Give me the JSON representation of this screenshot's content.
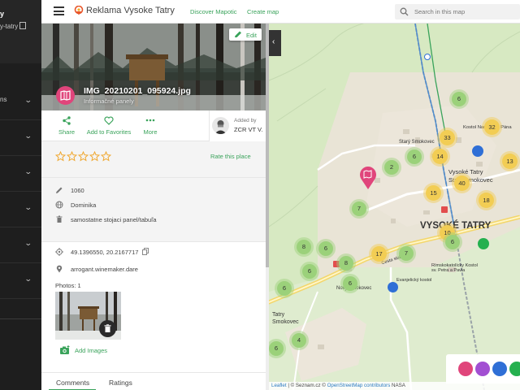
{
  "sidebar": {
    "title": "y",
    "subtitle": "y-tatry",
    "items": [
      {
        "label": "ns"
      },
      {
        "label": ""
      },
      {
        "label": ""
      },
      {
        "label": ""
      },
      {
        "label": ""
      },
      {
        "label": ""
      },
      {
        "label": ""
      }
    ]
  },
  "header": {
    "title": "Reklama Vysoke Tatry",
    "nav": [
      "Discover Mapotic",
      "Create map"
    ],
    "search_placeholder": "Search in this map"
  },
  "place": {
    "image_title": "IMG_20210201_095924.jpg",
    "category": "Informačné panely",
    "edit_label": "Edit",
    "actions": [
      {
        "label": "Share",
        "icon": "share-icon"
      },
      {
        "label": "Add to Favorites",
        "icon": "heart-icon"
      },
      {
        "label": "More",
        "icon": "more-icon"
      }
    ],
    "added_by_label": "Added by",
    "added_by_user": "ZCR VT V.",
    "rating": {
      "stars": 0,
      "max": 5,
      "rate_label": "Rate this place"
    },
    "details": [
      {
        "icon": "pencil-icon",
        "value": "1060"
      },
      {
        "icon": "globe-icon",
        "value": "Dominika"
      },
      {
        "icon": "trash-icon",
        "value": "samostatne stojaci panel/tabuľa"
      }
    ],
    "coordinates": "49.1396550, 20.2167717",
    "address": "arrogant.winemaker.dare",
    "photos_label": "Photos: 1",
    "add_images_label": "Add Images",
    "tabs": [
      "Comments",
      "Ratings"
    ]
  },
  "map": {
    "town_label": "VYSOKÉ TATRY",
    "labels": [
      "Starý Smokovec",
      "Vysoké Tatry",
      "Starý Smokovec",
      "Kostol Narodenia Pána",
      "Rímskokatolícky Kostol sv. Petra a Pavla",
      "Evanjelický kostol",
      "Nový Smokovec",
      "Tatry",
      "Smokovec",
      "Cesta slobody"
    ],
    "clusters": [
      {
        "count": "6",
        "color": "green"
      },
      {
        "count": "33",
        "color": "yellow"
      },
      {
        "count": "14",
        "color": "yellow"
      },
      {
        "count": "6",
        "color": "green"
      },
      {
        "count": "2",
        "color": "green"
      },
      {
        "count": "32",
        "color": "yellow"
      },
      {
        "count": "13",
        "color": "yellow"
      },
      {
        "count": "15",
        "color": "yellow"
      },
      {
        "count": "40",
        "color": "yellow"
      },
      {
        "count": "18",
        "color": "yellow"
      },
      {
        "count": "7",
        "color": "green"
      },
      {
        "count": "10",
        "color": "yellow"
      },
      {
        "count": "6",
        "color": "green"
      },
      {
        "count": "8",
        "color": "green"
      },
      {
        "count": "6",
        "color": "green"
      },
      {
        "count": "17",
        "color": "yellow"
      },
      {
        "count": "7",
        "color": "green"
      },
      {
        "count": "8",
        "color": "green"
      },
      {
        "count": "6",
        "color": "green"
      },
      {
        "count": "6",
        "color": "green"
      },
      {
        "count": "6",
        "color": "green"
      },
      {
        "count": "4",
        "color": "green"
      },
      {
        "count": "6",
        "color": "green"
      }
    ],
    "attribution": [
      "Leaflet",
      "|",
      "© Seznam.cz",
      "©",
      "OpenStreetMap contributors",
      "NASA"
    ],
    "legend_colors": [
      "#e0457b",
      "#a24fd2",
      "#2f6fd6",
      "#25b04f"
    ]
  },
  "colors": {
    "accent": "#3aa35b",
    "brand_pink": "#e0457b",
    "cluster_green": "#9bd17a",
    "cluster_yellow": "#f2cd54"
  }
}
